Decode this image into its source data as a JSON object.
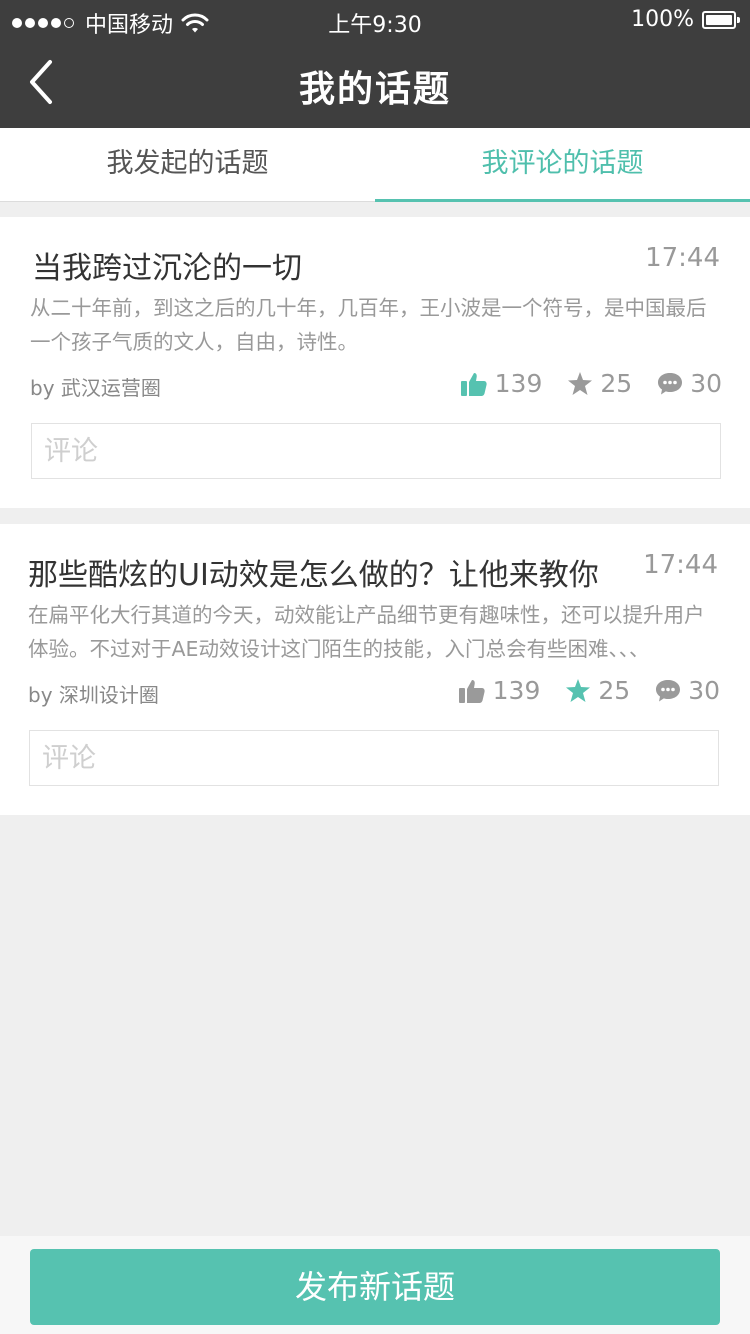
{
  "status_bar": {
    "carrier": "中国移动",
    "time": "上午9:30",
    "battery": "100%",
    "signal_bars": 4,
    "signal_max": 5
  },
  "nav": {
    "title": "我的话题",
    "back_icon": "chevron-left-icon"
  },
  "tabs": [
    {
      "label": "我发起的话题",
      "active": false
    },
    {
      "label": "我评论的话题",
      "active": true
    }
  ],
  "topics": [
    {
      "title": "当我跨过沉沦的一切",
      "time": "17:44",
      "summary": "从二十年前，到这之后的几十年，几百年，王小波是一个符号，是中国最后一个孩子气质的文人，自由，诗性。",
      "author": "by 武汉运营圈",
      "likes": "139",
      "stars": "25",
      "comments": "30",
      "liked": true,
      "starred": false,
      "comment_placeholder": "评论"
    },
    {
      "title": "那些酷炫的UI动效是怎么做的？让他来教你",
      "time": "17:44",
      "summary": "在扁平化大行其道的今天，动效能让产品细节更有趣味性，还可以提升用户体验。不过对于AE动效设计这门陌生的技能，入门总会有些困难、、、",
      "author": "by 深圳设计圈",
      "likes": "139",
      "stars": "25",
      "comments": "30",
      "liked": false,
      "starred": true,
      "comment_placeholder": "评论"
    }
  ],
  "bottom": {
    "publish_label": "发布新话题"
  },
  "colors": {
    "accent": "#56c2b0",
    "header_bg": "#3e3e3e",
    "inactive_icon": "#9a9a9a"
  }
}
